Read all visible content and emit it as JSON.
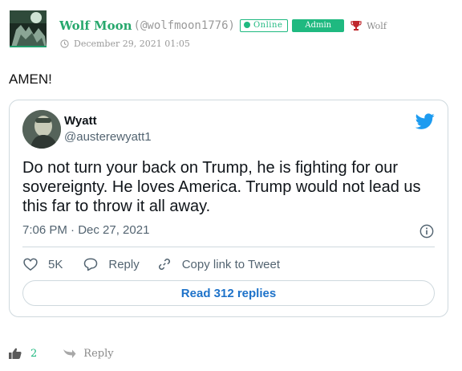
{
  "comment": {
    "author_name": "Wolf Moon",
    "author_handle": "(@wolfmoon1776)",
    "badge_online": "Online",
    "badge_admin": "Admin",
    "rank": "Wolf",
    "timestamp": "December 29, 2021 01:05",
    "text": "AMEN!",
    "like_count": "2",
    "reply_label": "Reply"
  },
  "tweet": {
    "name": "Wyatt",
    "handle": "@austerewyatt1",
    "text": "Do not turn your back on Trump, he is fighting for our sovereignty. He loves America. Trump would not lead us this far to throw it all away.",
    "time": "7:06 PM · Dec 27, 2021",
    "likes": "5K",
    "reply_label": "Reply",
    "copy_label": "Copy link to Tweet",
    "read_replies": "Read 312 replies"
  },
  "colors": {
    "accent_green": "#1fb980",
    "twitter_blue": "#1d9bf0"
  },
  "icons": [
    "clock-icon",
    "trophy-icon",
    "twitter-bird-icon",
    "info-icon",
    "heart-icon",
    "reply-bubble-icon",
    "link-icon",
    "thumbs-up-icon",
    "reply-arrow-icon"
  ]
}
